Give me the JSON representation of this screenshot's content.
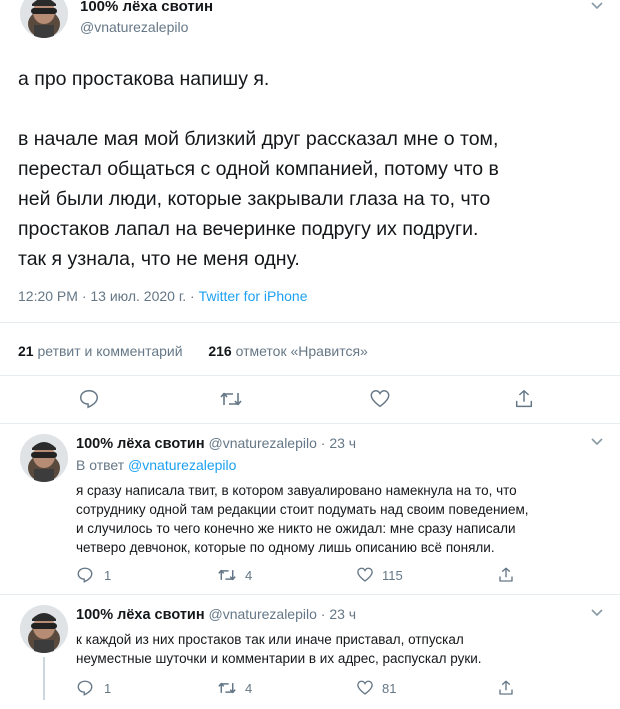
{
  "main_tweet": {
    "display_name": "100% лёха свотин",
    "handle": "@vnaturezalepilo",
    "text_lines": [
      "а про простакова напишу я.",
      "",
      "в начале мая мой близкий друг рассказал мне о том,",
      "перестал общаться с одной компанией, потому что в",
      "ней были люди, которые закрывали глаза на то, что",
      "простаков лапал на вечеринке подругу их подруги.",
      "так я узнала, что не меня одну."
    ],
    "time": "12:20 PM · 13 июл. 2020 г. · ",
    "source": "Twitter for iPhone",
    "retweets_count": "21",
    "retweets_label": " ретвит и комментарий",
    "likes_count": "216",
    "likes_label": " отметок «Нравится»"
  },
  "replies": [
    {
      "display_name": "100% лёха свотин",
      "handle_time": " @vnaturezalepilo · 23 ч",
      "in_reply_prefix": "В ответ ",
      "in_reply_handle": "@vnaturezalepilo",
      "text_lines": [
        "я сразу написала твит, в котором завуалировано намекнула на то, что",
        "сотруднику одной там редакции стоит подумать над своим поведением,",
        "и случилось то чего конечно же никто не ожидал: мне сразу написали",
        "четверо девчонок, которые по одному лишь описанию всё поняли."
      ],
      "reply_count": "1",
      "retweet_count": "4",
      "like_count": "115"
    },
    {
      "display_name": "100% лёха свотин",
      "handle_time": " @vnaturezalepilo · 23 ч",
      "text_lines": [
        "к каждой из них простаков так или иначе приставал, отпускал",
        "неуместные шуточки и комментарии в их адрес, распускал руки."
      ],
      "reply_count": "1",
      "retweet_count": "4",
      "like_count": "81"
    }
  ],
  "colors": {
    "accent": "#1da1f2",
    "muted": "#657786",
    "divider": "#e6ecf0"
  },
  "icons": [
    "chevron-down-icon",
    "reply-icon",
    "retweet-icon",
    "like-icon",
    "share-icon"
  ]
}
